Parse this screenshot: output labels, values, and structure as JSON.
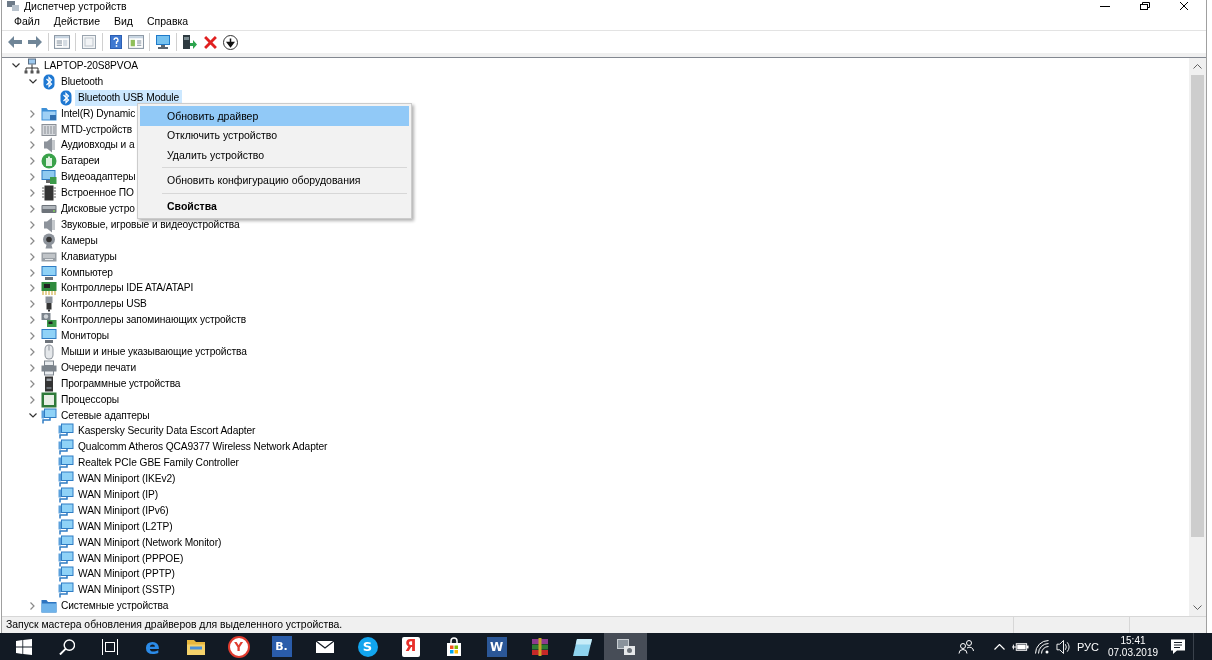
{
  "window": {
    "title": "Диспетчер устройств"
  },
  "menu": [
    "Файл",
    "Действие",
    "Вид",
    "Справка"
  ],
  "tree": [
    {
      "label": "LAPTOP-20S8PVOA",
      "kind": "computer",
      "expanded": true,
      "selected": false,
      "children": [
        {
          "label": "Bluetooth",
          "kind": "bluetooth",
          "expanded": true,
          "selected": false,
          "children": [
            {
              "label": "Bluetooth USB Module",
              "kind": "bluetooth",
              "selected": true
            }
          ]
        },
        {
          "label": "Intel(R) Dynamic",
          "kind": "platform",
          "expanded": false,
          "selected": false
        },
        {
          "label": "MTD-устройств",
          "kind": "card",
          "expanded": false,
          "selected": false
        },
        {
          "label": "Аудиовходы и а",
          "kind": "audio",
          "expanded": false,
          "selected": false
        },
        {
          "label": "Батареи",
          "kind": "battery",
          "expanded": false,
          "selected": false
        },
        {
          "label": "Видеоадаптеры",
          "kind": "display",
          "expanded": false,
          "selected": false
        },
        {
          "label": "Встроенное ПО",
          "kind": "firmware",
          "expanded": false,
          "selected": false
        },
        {
          "label": "Дисковые устро",
          "kind": "disk",
          "expanded": false,
          "selected": false
        },
        {
          "label": "Звуковые, игровые и видеоустройства",
          "kind": "sound",
          "expanded": false,
          "selected": false
        },
        {
          "label": "Камеры",
          "kind": "camera",
          "expanded": false,
          "selected": false
        },
        {
          "label": "Клавиатуры",
          "kind": "keyboard",
          "expanded": false,
          "selected": false
        },
        {
          "label": "Компьютер",
          "kind": "pc",
          "expanded": false,
          "selected": false
        },
        {
          "label": "Контроллеры IDE ATA/ATAPI",
          "kind": "ide",
          "expanded": false,
          "selected": false
        },
        {
          "label": "Контроллеры USB",
          "kind": "usb",
          "expanded": false,
          "selected": false
        },
        {
          "label": "Контроллеры запоминающих устройств",
          "kind": "storage",
          "expanded": false,
          "selected": false
        },
        {
          "label": "Мониторы",
          "kind": "monitor",
          "expanded": false,
          "selected": false
        },
        {
          "label": "Мыши и иные указывающие устройства",
          "kind": "mouse",
          "expanded": false,
          "selected": false
        },
        {
          "label": "Очереди печати",
          "kind": "printer",
          "expanded": false,
          "selected": false
        },
        {
          "label": "Программные устройства",
          "kind": "software",
          "expanded": false,
          "selected": false
        },
        {
          "label": "Процессоры",
          "kind": "processor",
          "expanded": false,
          "selected": false
        },
        {
          "label": "Сетевые адаптеры",
          "kind": "network",
          "expanded": true,
          "selected": false,
          "children": [
            {
              "label": "Kaspersky Security Data Escort Adapter",
              "kind": "network",
              "selected": false
            },
            {
              "label": "Qualcomm Atheros QCA9377 Wireless Network Adapter",
              "kind": "network",
              "selected": false
            },
            {
              "label": "Realtek PCIe GBE Family Controller",
              "kind": "network",
              "selected": false
            },
            {
              "label": "WAN Miniport (IKEv2)",
              "kind": "network",
              "selected": false
            },
            {
              "label": "WAN Miniport (IP)",
              "kind": "network",
              "selected": false
            },
            {
              "label": "WAN Miniport (IPv6)",
              "kind": "network",
              "selected": false
            },
            {
              "label": "WAN Miniport (L2TP)",
              "kind": "network",
              "selected": false
            },
            {
              "label": "WAN Miniport (Network Monitor)",
              "kind": "network",
              "selected": false
            },
            {
              "label": "WAN Miniport (PPPOE)",
              "kind": "network",
              "selected": false
            },
            {
              "label": "WAN Miniport (PPTP)",
              "kind": "network",
              "selected": false
            },
            {
              "label": "WAN Miniport (SSTP)",
              "kind": "network",
              "selected": false
            }
          ]
        },
        {
          "label": "Системные устройства",
          "kind": "system",
          "expanded": false,
          "selected": false
        }
      ]
    }
  ],
  "context_menu": {
    "items": [
      {
        "kind": "item",
        "label": "Обновить драйвер",
        "selected": true,
        "default": false
      },
      {
        "kind": "item",
        "label": "Отключить устройство",
        "selected": false,
        "default": false
      },
      {
        "kind": "item",
        "label": "Удалить устройство",
        "selected": false,
        "default": false
      },
      {
        "kind": "separator"
      },
      {
        "kind": "item",
        "label": "Обновить конфигурацию оборудования",
        "selected": false,
        "default": false
      },
      {
        "kind": "separator"
      },
      {
        "kind": "item",
        "label": "Свойства",
        "selected": false,
        "default": true
      }
    ]
  },
  "status_bar": {
    "text": "Запуск мастера обновления драйверов для выделенного устройства."
  },
  "taskbar": {
    "apps": [
      {
        "kind": "edge",
        "glyph": "e",
        "selected": false
      },
      {
        "kind": "folder",
        "selected": false
      },
      {
        "kind": "ybrowser",
        "glyph": "Y",
        "selected": false
      },
      {
        "kind": "tile",
        "glyph": "B.",
        "selected": false
      },
      {
        "kind": "mail",
        "selected": false
      },
      {
        "kind": "skype",
        "glyph": "S",
        "selected": false
      },
      {
        "kind": "yandex",
        "glyph": "Я",
        "selected": false
      },
      {
        "kind": "store",
        "selected": false
      },
      {
        "kind": "word",
        "glyph": "W",
        "selected": false
      },
      {
        "kind": "archive",
        "selected": false
      },
      {
        "kind": "notes",
        "selected": false
      },
      {
        "kind": "devices",
        "selected": true
      }
    ],
    "language": "РУС",
    "time": "15:41",
    "date": "07.03.2019"
  }
}
